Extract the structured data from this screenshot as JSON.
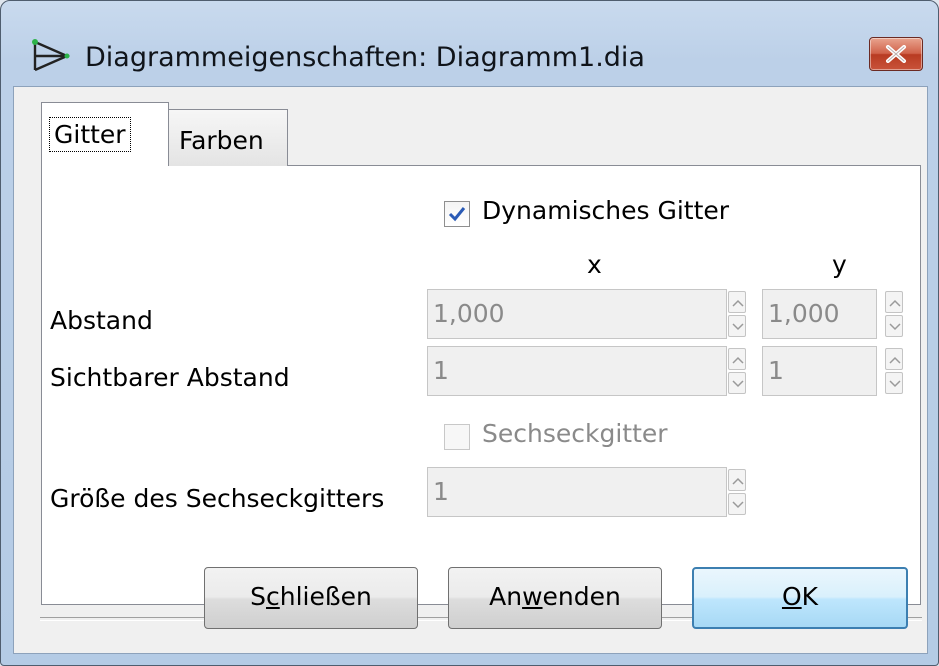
{
  "window": {
    "title": "Diagrammeigenschaften: Diagramm1.dia",
    "icon": "dia-app-icon",
    "close_icon": "close-icon"
  },
  "tabs": [
    {
      "label": "Gitter",
      "active": true
    },
    {
      "label": "Farben",
      "active": false
    }
  ],
  "grid": {
    "dynamic_grid": {
      "label": "Dynamisches Gitter",
      "checked": true
    },
    "column_x": "x",
    "column_y": "y",
    "spacing": {
      "label": "Abstand",
      "x": "1,000",
      "y": "1,000"
    },
    "visible_spacing": {
      "label": "Sichtbarer Abstand",
      "x": "1",
      "y": "1"
    },
    "hex_grid": {
      "label": "Sechseckgitter",
      "checked": false,
      "enabled": false
    },
    "hex_size": {
      "label": "Größe des Sechseckgitters",
      "value": "1"
    }
  },
  "buttons": {
    "close": {
      "pre": "S",
      "mnemonic": "c",
      "post": "hließen"
    },
    "apply": {
      "pre": "An",
      "mnemonic": "w",
      "post": "enden"
    },
    "ok": {
      "pre": "",
      "mnemonic": "O",
      "post": "K"
    }
  },
  "colors": {
    "accent": "#3c7fb1",
    "close_red": "#c9533a",
    "check_blue": "#2a5ab5"
  }
}
